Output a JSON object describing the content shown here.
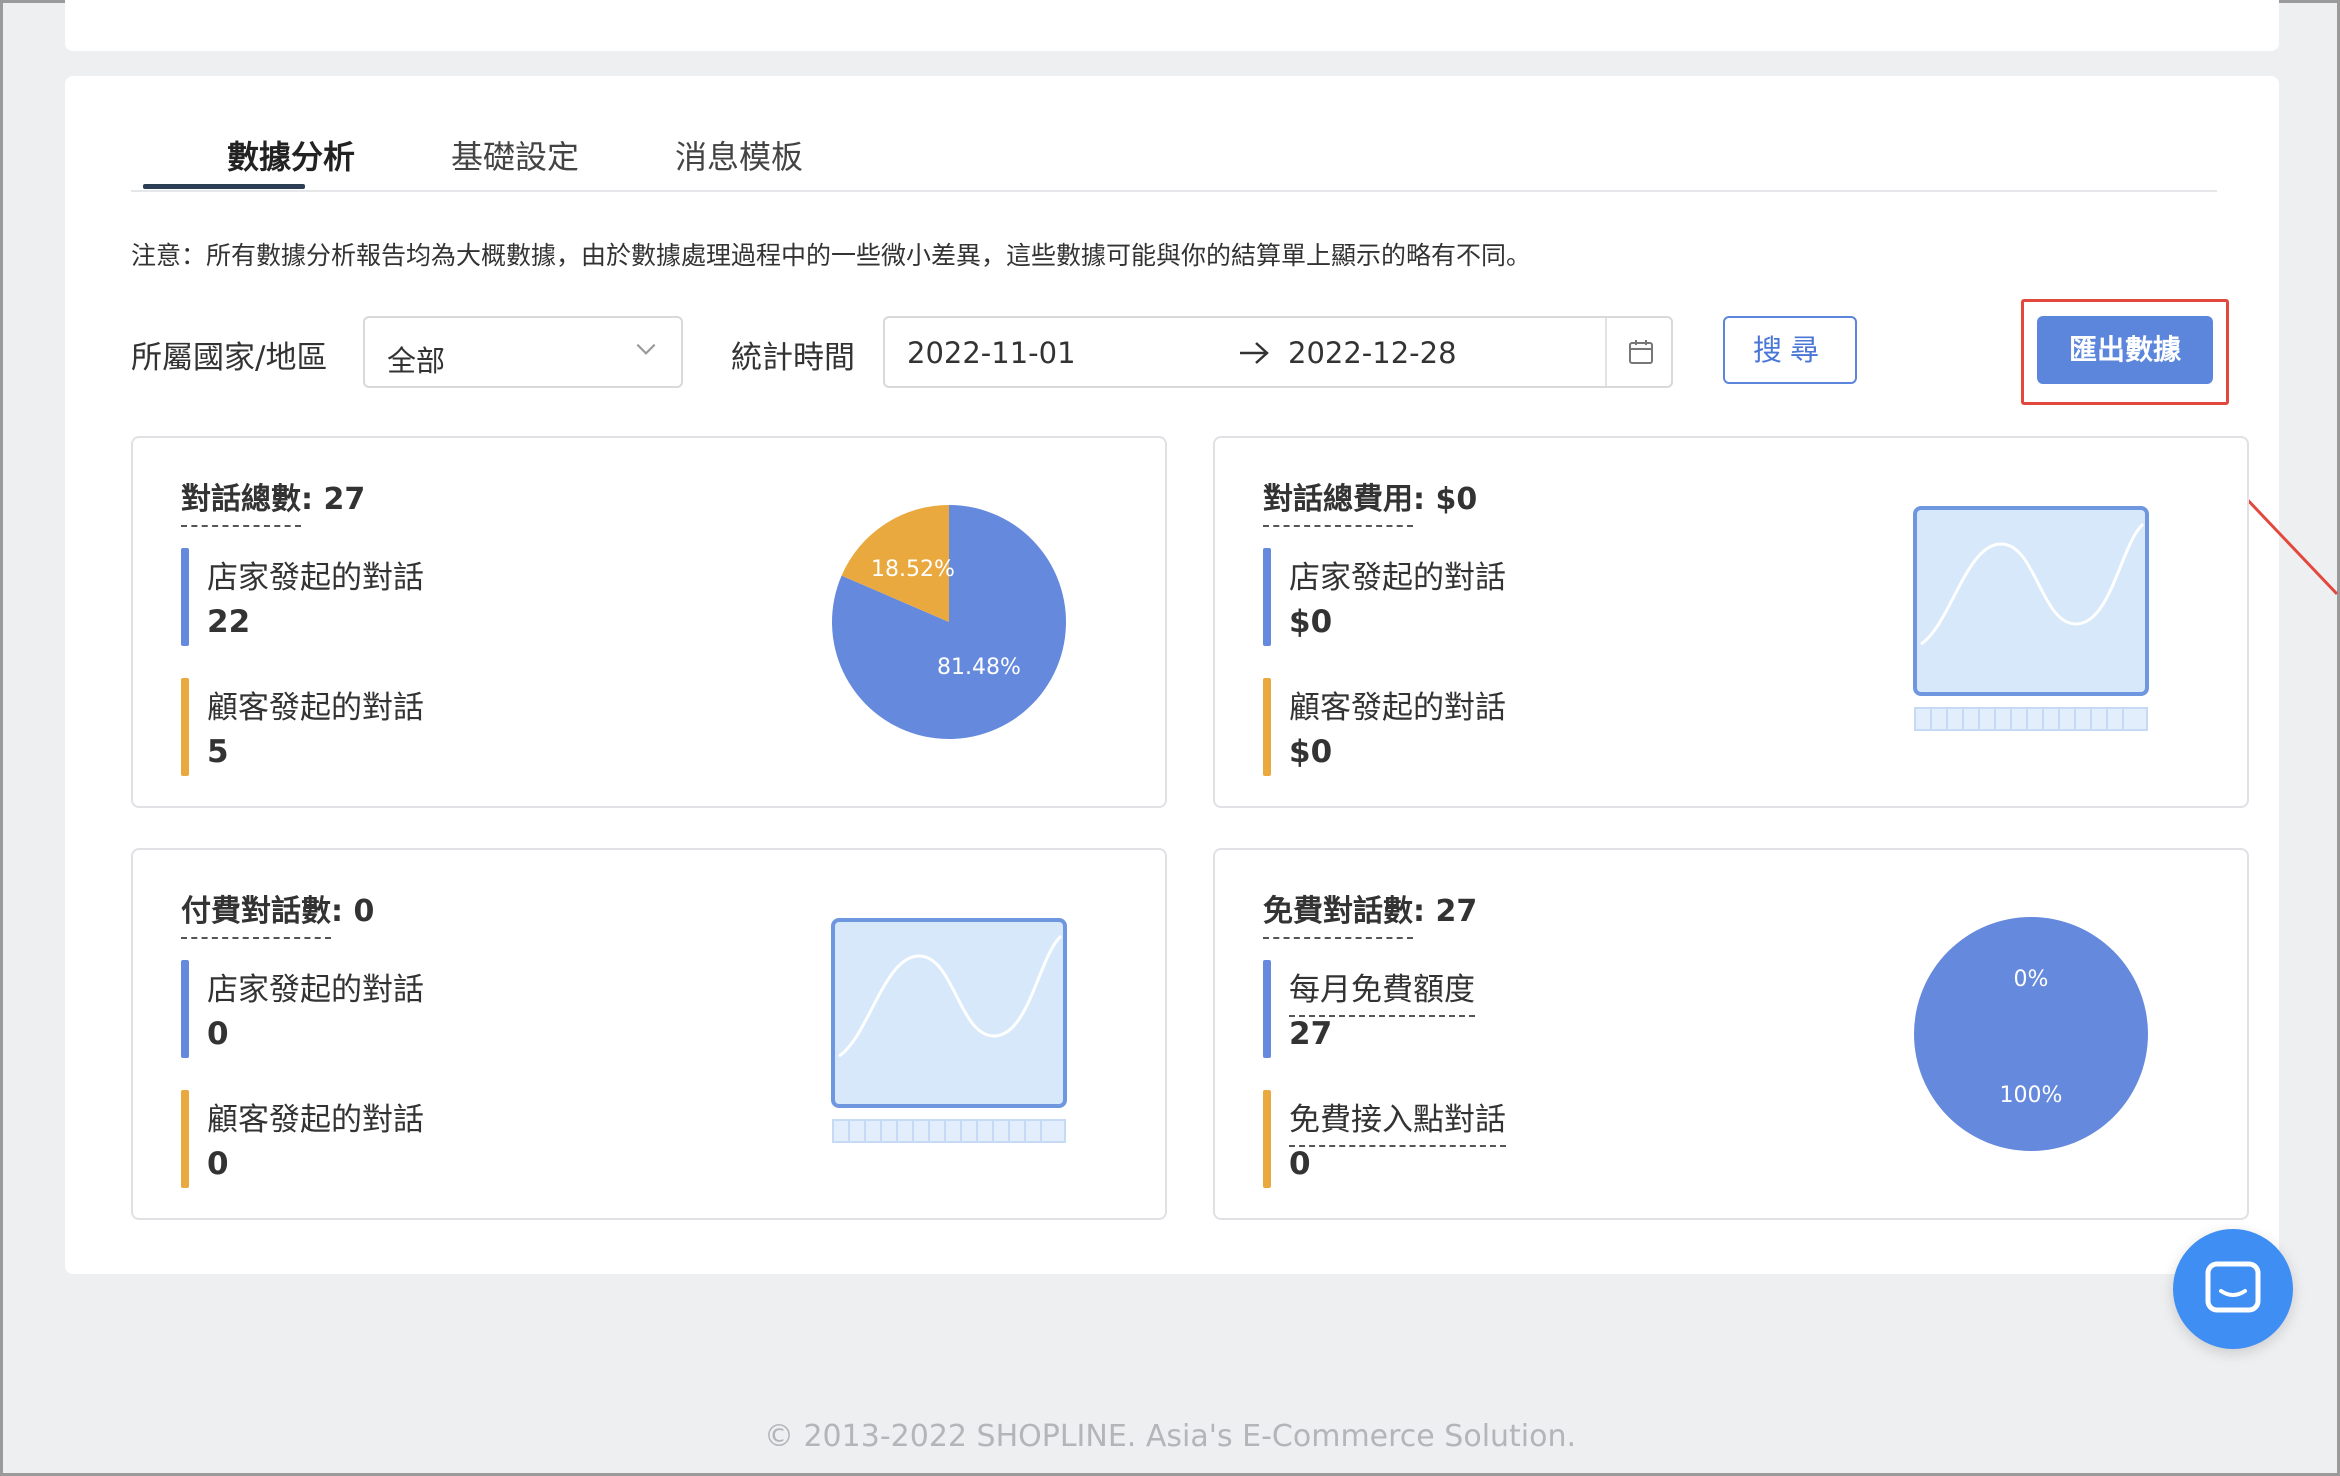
{
  "tabs": [
    {
      "label": "數據分析",
      "active": true
    },
    {
      "label": "基礎設定",
      "active": false
    },
    {
      "label": "消息模板",
      "active": false
    }
  ],
  "notice": "注意：所有數據分析報告均為大概數據，由於數據處理過程中的一些微小差異，這些數據可能與你的結算單上顯示的略有不同。",
  "filters": {
    "region_label": "所屬國家/地區",
    "region_value": "全部",
    "time_label": "統計時間",
    "date_start": "2022-11-01",
    "date_end": "2022-12-28",
    "search_label": "搜尋",
    "export_label": "匯出數據"
  },
  "cards": {
    "total": {
      "title": "對話總數",
      "value": "27",
      "metrics": [
        {
          "label": "店家發起的對話",
          "value": "22"
        },
        {
          "label": "顧客發起的對話",
          "value": "5"
        }
      ],
      "pie": {
        "slices": [
          {
            "label": "81.48%",
            "value": 81.48,
            "color": "#6589dd"
          },
          {
            "label": "18.52%",
            "value": 18.52,
            "color": "#e9a93f"
          }
        ]
      }
    },
    "cost": {
      "title": "對話總費用",
      "value": "$0",
      "metrics": [
        {
          "label": "店家發起的對話",
          "value": "$0"
        },
        {
          "label": "顧客發起的對話",
          "value": "$0"
        }
      ]
    },
    "paid": {
      "title": "付費對話數",
      "value": "0",
      "metrics": [
        {
          "label": "店家發起的對話",
          "value": "0"
        },
        {
          "label": "顧客發起的對話",
          "value": "0"
        }
      ]
    },
    "free": {
      "title": "免費對話數",
      "value": "27",
      "metrics": [
        {
          "label": "每月免費額度",
          "value": "27"
        },
        {
          "label": "免費接入點對話",
          "value": "0"
        }
      ],
      "pie": {
        "slices": [
          {
            "label": "100%",
            "value": 100,
            "color": "#6589dd"
          },
          {
            "label": "0%",
            "value": 0,
            "color": "#e9a93f"
          }
        ]
      }
    }
  },
  "colors": {
    "accent": "#5b86dc",
    "store_bar": "#6589dd",
    "customer_bar": "#e9a93f",
    "highlight": "#e2483d",
    "chat": "#3f8ef3"
  },
  "footer": "© 2013-2022 SHOPLINE. Asia's E-Commerce Solution."
}
